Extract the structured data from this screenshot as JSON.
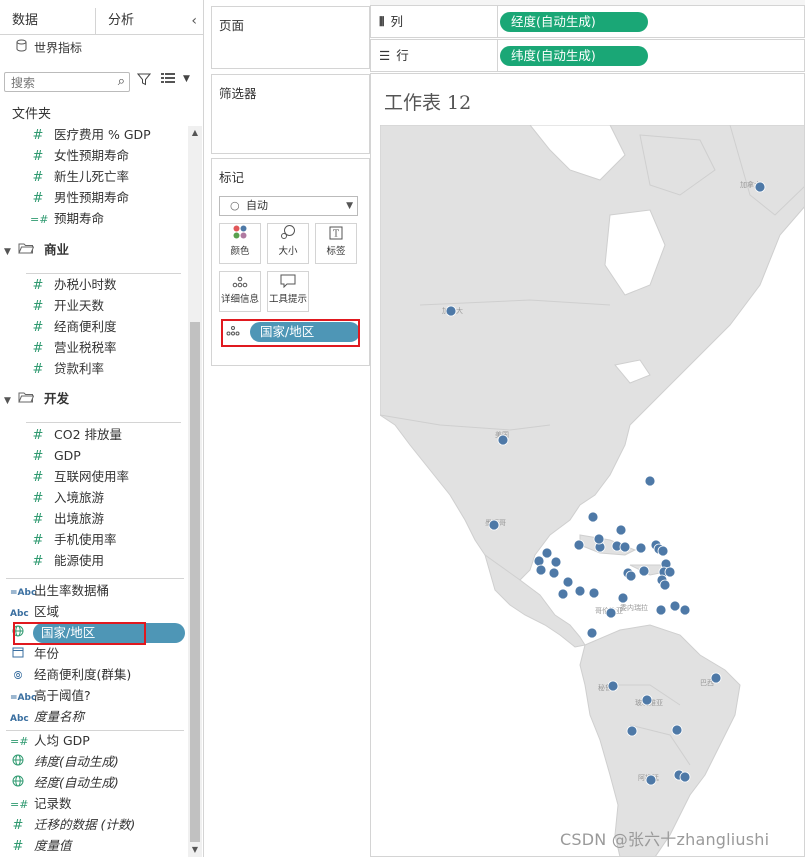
{
  "tabs": {
    "data": "数据",
    "analysis": "分析",
    "collapse": "‹"
  },
  "datasource": {
    "name": "世界指标"
  },
  "search": {
    "placeholder": "搜索"
  },
  "folder_title": "文件夹",
  "fields_health": [
    {
      "label": "医疗费用 % GDP",
      "icon": "#"
    },
    {
      "label": "女性预期寿命",
      "icon": "#"
    },
    {
      "label": "新生儿死亡率",
      "icon": "#"
    },
    {
      "label": "男性预期寿命",
      "icon": "#"
    },
    {
      "label": "预期寿命",
      "icon": "=#"
    }
  ],
  "group_business": {
    "label": "商业"
  },
  "fields_business": [
    "办税小时数",
    "开业天数",
    "经商便利度",
    "营业税税率",
    "贷款利率"
  ],
  "group_develop": {
    "label": "开发"
  },
  "fields_develop": [
    "CO2 排放量",
    "GDP",
    "互联网使用率",
    "入境旅游",
    "出境旅游",
    "手机使用率",
    "能源使用"
  ],
  "dimensions": [
    {
      "label": "出生率数据桶",
      "icon": "=Abc"
    },
    {
      "label": "区域",
      "icon": "Abc"
    },
    {
      "label": "国家/地区",
      "icon": "globe"
    },
    {
      "label": "年份",
      "icon": "calendar"
    },
    {
      "label": "经商便利度(群集)",
      "icon": "cluster"
    },
    {
      "label": "高于阈值?",
      "icon": "=Abc"
    },
    {
      "label": "度量名称",
      "icon": "Abc",
      "italic": true
    }
  ],
  "measures": [
    {
      "label": "人均 GDP",
      "icon": "=#"
    },
    {
      "label": "纬度(自动生成)",
      "icon": "globe",
      "italic": true
    },
    {
      "label": "经度(自动生成)",
      "icon": "globe",
      "italic": true
    },
    {
      "label": "记录数",
      "icon": "=#"
    },
    {
      "label": "迁移的数据 (计数)",
      "icon": "#",
      "italic": true
    },
    {
      "label": "度量值",
      "icon": "#",
      "italic": true
    }
  ],
  "cards": {
    "pages": "页面",
    "filters": "筛选器",
    "marks": "标记",
    "mark_type": "自动",
    "buttons": [
      "颜色",
      "大小",
      "标签",
      "详细信息",
      "工具提示"
    ],
    "mark_field": "国家/地区"
  },
  "shelves": {
    "columns_label": "列",
    "columns_pill": "经度(自动生成)",
    "rows_label": "行",
    "rows_pill": "纬度(自动生成)"
  },
  "sheet": {
    "title": "工作表 12"
  },
  "map_labels": [
    "加拿大",
    "美国",
    "墨西哥",
    "委内瑞拉",
    "哥伦比亚",
    "巴西",
    "秘鲁",
    "玻利维亚",
    "阿根廷"
  ],
  "watermark": "CSDN @张六十zhangliushi",
  "colors": {
    "pill_dim": "#4e96b6",
    "pill_measure": "#1aa776",
    "mark": "#4e79a7",
    "highlight": "#e0191f"
  }
}
